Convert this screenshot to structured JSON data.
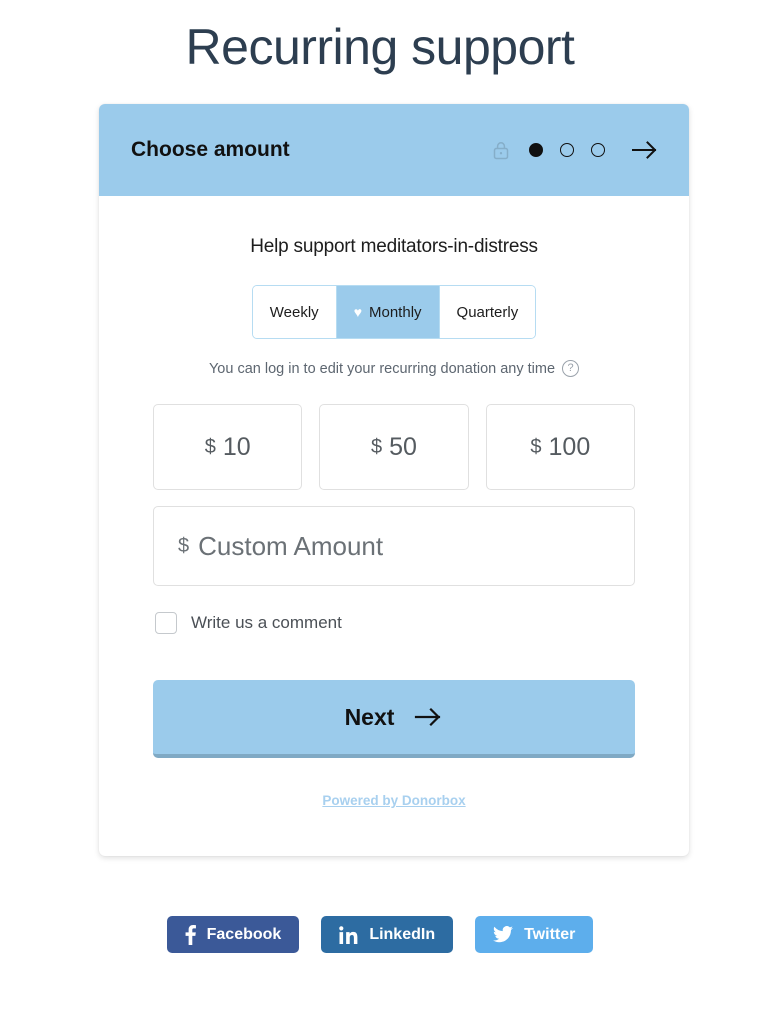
{
  "page": {
    "title": "Recurring support"
  },
  "card": {
    "header": {
      "title": "Choose amount",
      "lock_icon": "lock-icon",
      "next_arrow_icon": "arrow-right-icon",
      "steps": [
        {
          "index": 1,
          "state": "active"
        },
        {
          "index": 2,
          "state": "inactive"
        },
        {
          "index": 3,
          "state": "inactive"
        }
      ]
    },
    "body": {
      "support_heading": "Help support meditators-in-distress",
      "intervals": [
        {
          "label": "Weekly",
          "selected": false,
          "icon": null
        },
        {
          "label": "Monthly",
          "selected": true,
          "icon": "heart-icon"
        },
        {
          "label": "Quarterly",
          "selected": false,
          "icon": null
        }
      ],
      "note": {
        "text": "You can log in to edit your recurring donation any time",
        "help_icon": "question-mark-icon",
        "help_glyph": "?"
      },
      "amounts": [
        {
          "currency": "$",
          "value": "10"
        },
        {
          "currency": "$",
          "value": "50"
        },
        {
          "currency": "$",
          "value": "100"
        }
      ],
      "custom_amount": {
        "currency": "$",
        "placeholder": "Custom Amount",
        "value": ""
      },
      "comment": {
        "label": "Write us a comment",
        "checked": false
      },
      "next_button": {
        "label": "Next",
        "icon": "arrow-right-icon"
      },
      "powered_by": {
        "text": "Powered by Donorbox"
      }
    }
  },
  "social": [
    {
      "label": "Facebook",
      "icon": "facebook-icon",
      "color": "#3b5998"
    },
    {
      "label": "LinkedIn",
      "icon": "linkedin-icon",
      "color": "#2d6ca2"
    },
    {
      "label": "Twitter",
      "icon": "twitter-icon",
      "color": "#5daeec"
    }
  ],
  "colors": {
    "brand_blue": "#9bcbeb",
    "title_text": "#2d3e50",
    "link_blue": "#a8d0ef",
    "next_shadow": "#7fa9c4"
  }
}
